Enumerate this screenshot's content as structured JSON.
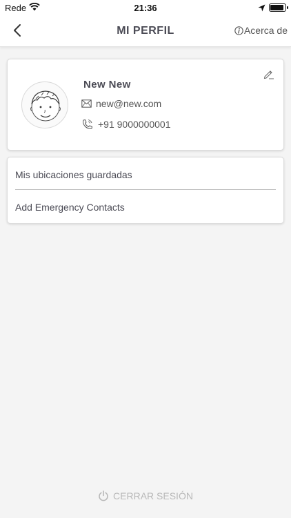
{
  "status_bar": {
    "carrier": "Rede",
    "time": "21:36"
  },
  "nav": {
    "title": "MI PERFIL",
    "about_label": "Acerca de"
  },
  "profile": {
    "name": "New New",
    "email": "new@new.com",
    "phone": "+91 9000000001"
  },
  "menu": {
    "items": [
      {
        "label": "Mis ubicaciones guardadas"
      },
      {
        "label": "Add Emergency Contacts"
      }
    ]
  },
  "logout": {
    "label": "CERRAR SESIÓN"
  },
  "icons": {
    "back": "back-arrow-icon",
    "about": "info-icon",
    "edit": "pencil-icon",
    "email": "envelope-icon",
    "phone": "phone-icon",
    "logout": "power-icon"
  },
  "colors": {
    "background": "#f4f4f4",
    "card": "#ffffff",
    "text": "#4a4a54",
    "muted": "#b8b8b8"
  }
}
